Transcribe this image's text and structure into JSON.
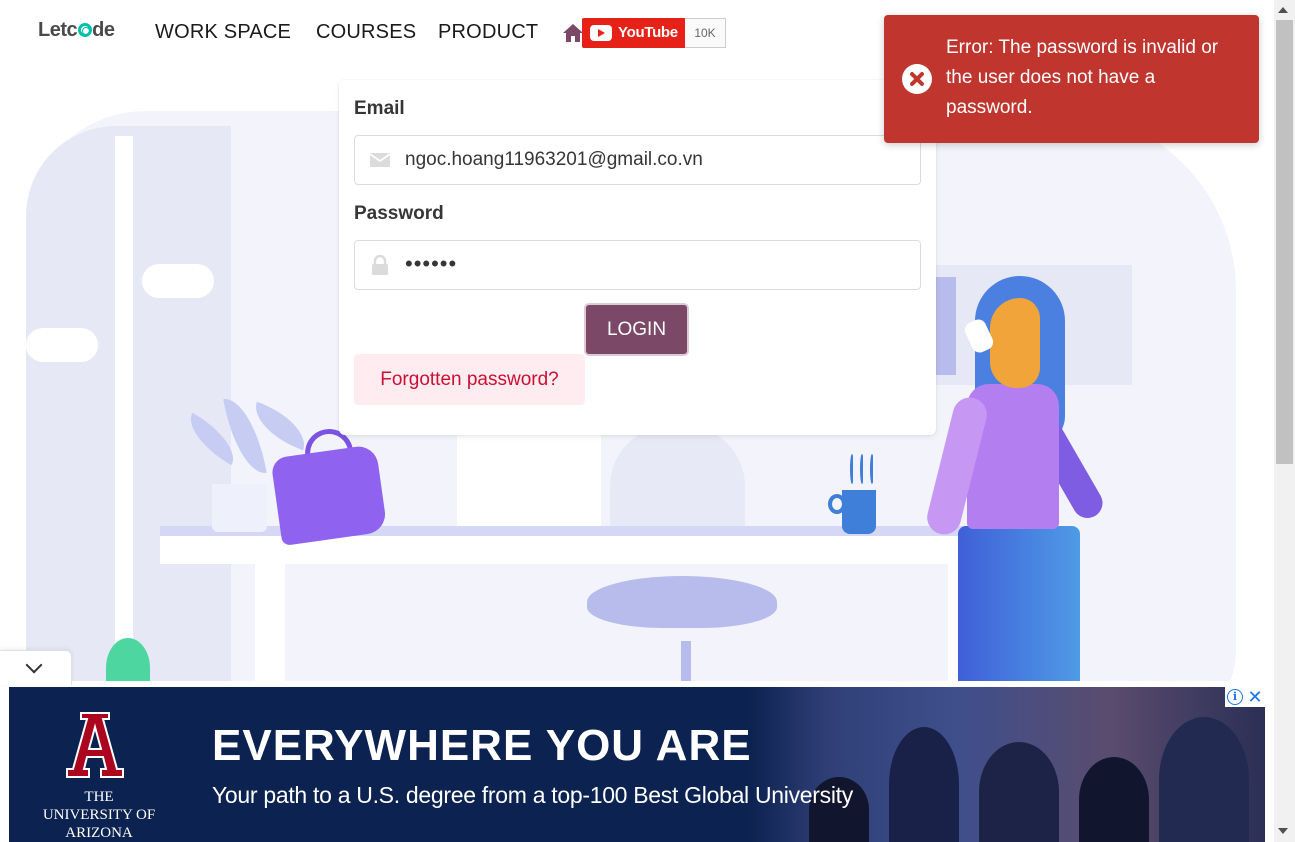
{
  "navbar": {
    "logo": {
      "part1": "Let",
      "part2": "c",
      "part3": "de"
    },
    "items": [
      {
        "label": "WORK SPACE"
      },
      {
        "label": "COURSES"
      },
      {
        "label": "PRODUCT"
      }
    ],
    "home_icon": "home-icon",
    "youtube": {
      "label": "YouTube",
      "count": "10K",
      "color": "#e62117"
    }
  },
  "login_form": {
    "email": {
      "label": "Email",
      "value": "ngoc.hoang11963201@gmail.co.vn",
      "icon": "envelope-icon"
    },
    "password": {
      "label": "Password",
      "value": "••••••",
      "icon": "lock-icon"
    },
    "login_button": "LOGIN",
    "forgot_button": "Forgotten password?",
    "colors": {
      "primary": "#7b4868",
      "danger_light": "#feecf0",
      "danger_text": "#cc0f35"
    }
  },
  "toast": {
    "icon": "error-circle-icon",
    "message": "Error: The password is invalid or the user does not have a password.",
    "color": "#c0362f"
  },
  "ad": {
    "logo_letter": "A",
    "logo_text": "THE UNIVERSITY OF ARIZONA",
    "headline": "EVERYWHERE YOU ARE",
    "subline": "Your path to a U.S. degree from a top-100 Best Global University",
    "info_icon": "i",
    "close_icon": "✕",
    "color": "#0c2250"
  },
  "collapse_icon": "chevron-down-icon"
}
